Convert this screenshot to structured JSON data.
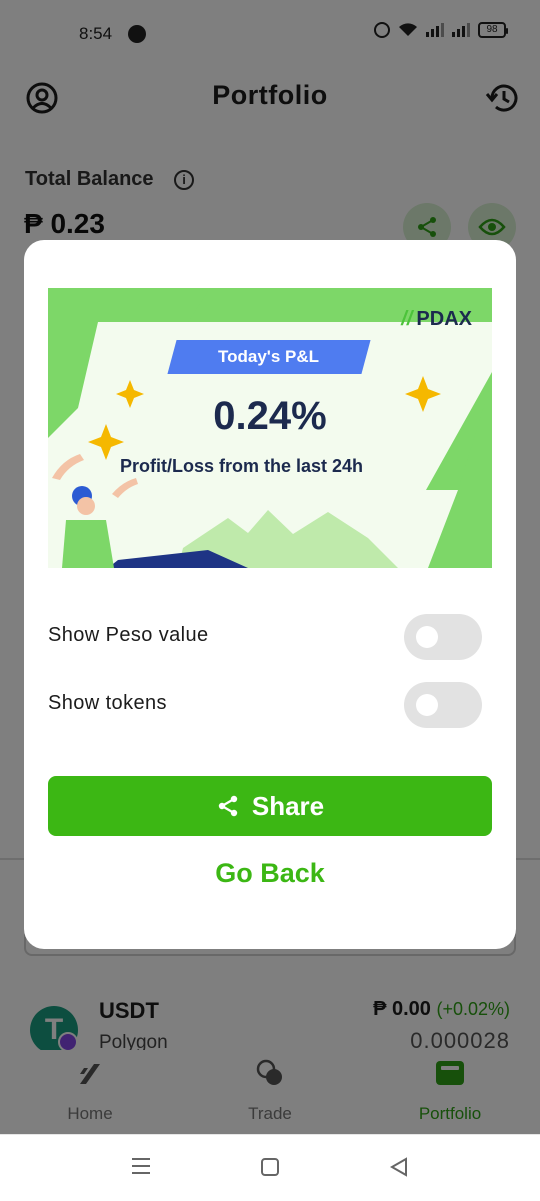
{
  "status_bar": {
    "time": "8:54",
    "battery": "98"
  },
  "header": {
    "title": "Portfolio"
  },
  "balance": {
    "label": "Total Balance",
    "value": "₱ 0.23"
  },
  "asset": {
    "name": "USDT",
    "network": "Polygon",
    "value": "₱ 0.00",
    "change": "(+0.02%)",
    "amount": "0.000028"
  },
  "nav": {
    "home": "Home",
    "trade": "Trade",
    "portfolio": "Portfolio"
  },
  "modal": {
    "brand": "PDAX",
    "tag": "Today's P&L",
    "pnl_value": "0.24%",
    "pnl_caption": "Profit/Loss from the last 24h",
    "toggles": [
      {
        "label": "Show Peso value",
        "on": false
      },
      {
        "label": "Show tokens",
        "on": false
      }
    ],
    "share_label": "Share",
    "go_back_label": "Go Back"
  },
  "colors": {
    "accent": "#3cb714",
    "navy": "#1c2a4e",
    "tag_blue": "#4f7cf0",
    "banner_green": "#7dd768"
  }
}
